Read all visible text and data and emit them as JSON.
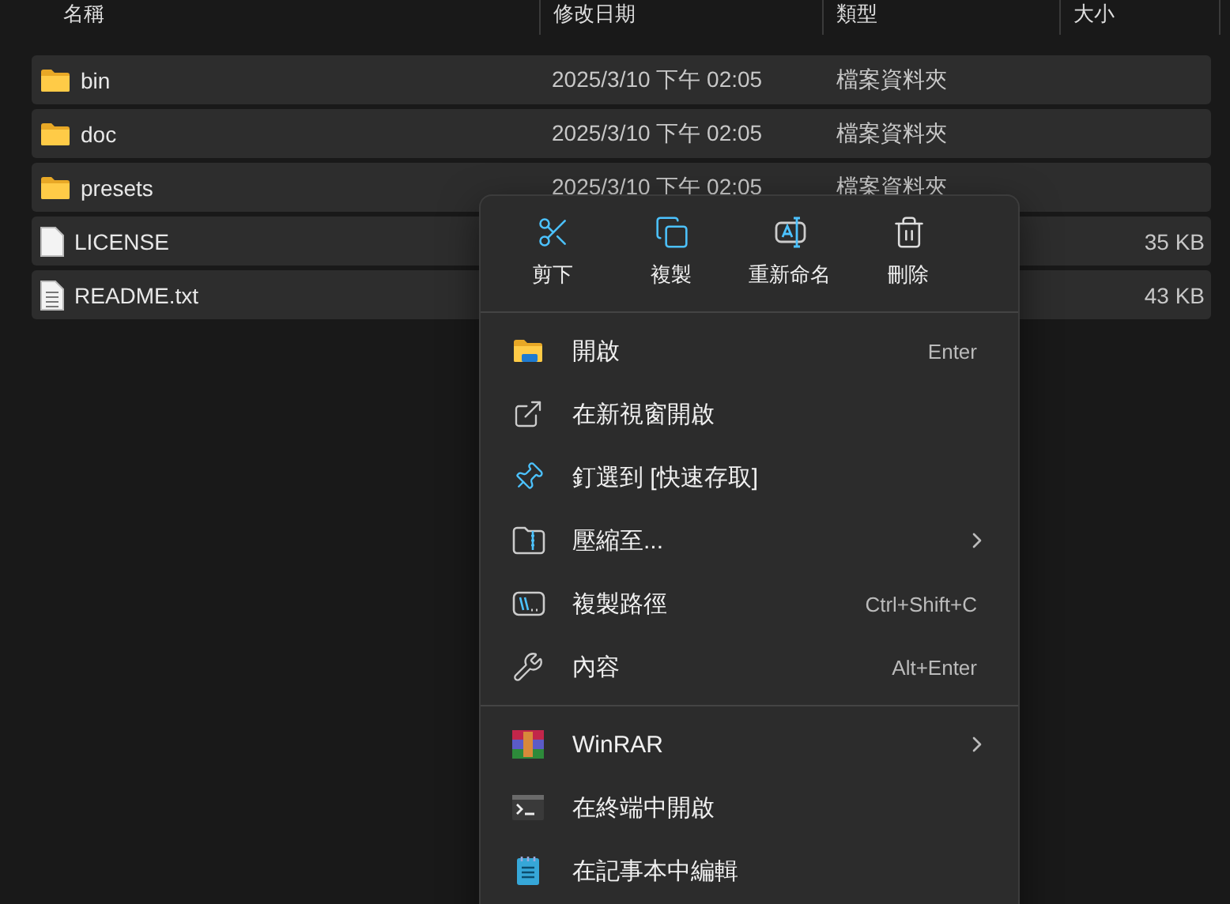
{
  "columns": [
    {
      "label": "名稱"
    },
    {
      "label": "修改日期"
    },
    {
      "label": "類型"
    },
    {
      "label": "大小"
    }
  ],
  "rows": [
    {
      "kind": "folder",
      "name": "bin",
      "date": "2025/3/10 下午 02:05",
      "type": "檔案資料夾",
      "selected": true
    },
    {
      "kind": "folder",
      "name": "doc",
      "date": "2025/3/10 下午 02:05",
      "type": "檔案資料夾",
      "selected": true
    },
    {
      "kind": "folder",
      "name": "presets",
      "date": "2025/3/10 下午 02:05",
      "type": "檔案資料夾",
      "selected": true
    },
    {
      "kind": "file",
      "name": "LICENSE",
      "size": "35 KB",
      "selected": true
    },
    {
      "kind": "text",
      "name": "README.txt",
      "size": "43 KB",
      "selected": true
    }
  ],
  "menu": {
    "actions": [
      {
        "kind": "cut",
        "label": "剪下"
      },
      {
        "kind": "copy",
        "label": "複製"
      },
      {
        "kind": "rename",
        "label": "重新命名"
      },
      {
        "kind": "delete",
        "label": "刪除"
      }
    ],
    "groups": [
      [
        {
          "kind": "open",
          "label": "開啟",
          "shortcut": "Enter",
          "submenu": false
        },
        {
          "kind": "new-window",
          "label": "在新視窗開啟",
          "submenu": false
        },
        {
          "kind": "pin",
          "label": "釘選到 [快速存取]",
          "submenu": false
        },
        {
          "kind": "zip",
          "label": "壓縮至...",
          "submenu": true
        },
        {
          "kind": "copy-path",
          "label": "複製路徑",
          "shortcut": "Ctrl+Shift+C",
          "submenu": false
        },
        {
          "kind": "properties",
          "label": "內容",
          "shortcut": "Alt+Enter",
          "submenu": false
        }
      ],
      [
        {
          "kind": "winrar",
          "label": "WinRAR",
          "submenu": true
        },
        {
          "kind": "terminal",
          "label": "在終端中開啟",
          "submenu": false
        },
        {
          "kind": "notepad",
          "label": "在記事本中編輯",
          "submenu": false
        }
      ]
    ]
  }
}
